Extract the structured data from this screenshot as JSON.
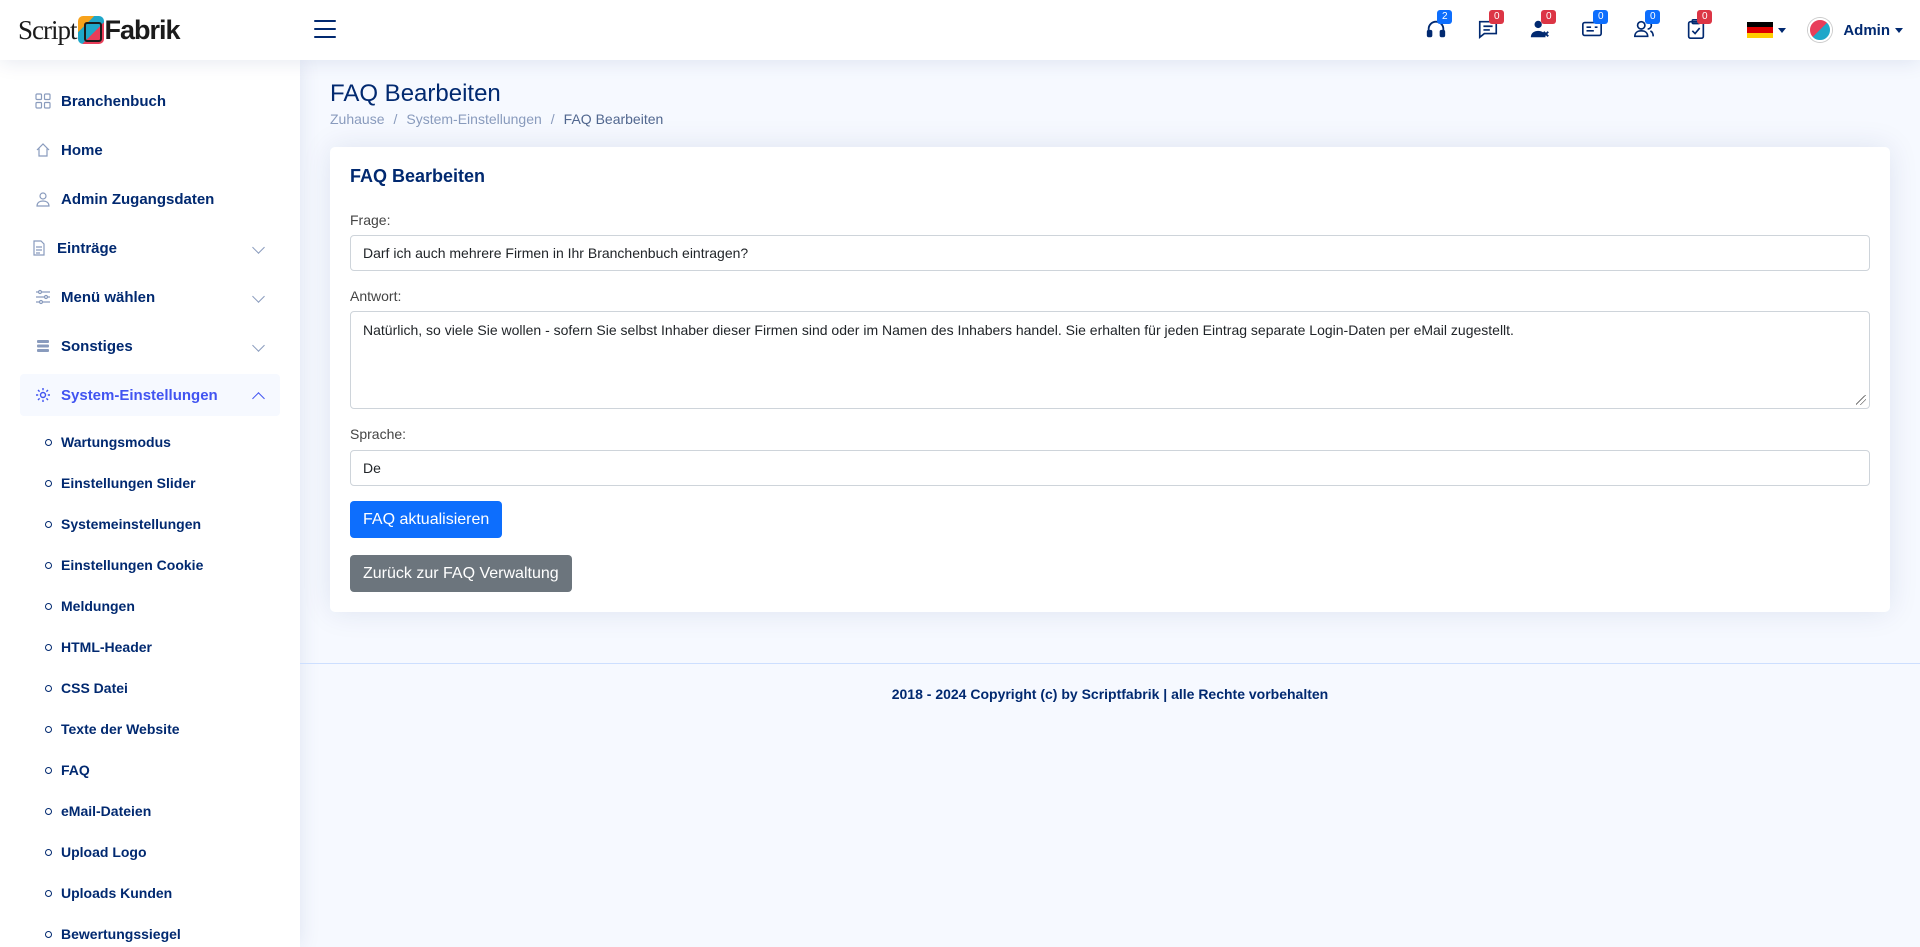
{
  "header": {
    "logo_script": "Script",
    "logo_fabrik": "Fabrik",
    "notifications": [
      {
        "icon": "headset-icon",
        "count": "2",
        "color": "blue"
      },
      {
        "icon": "chat-icon",
        "count": "0",
        "color": "red"
      },
      {
        "icon": "user-x-icon",
        "count": "0",
        "color": "red"
      },
      {
        "icon": "card-icon",
        "count": "0",
        "color": "blue"
      },
      {
        "icon": "users-icon",
        "count": "0",
        "color": "blue"
      },
      {
        "icon": "clipboard-check-icon",
        "count": "0",
        "color": "red"
      }
    ],
    "language_flag": "de",
    "user_name": "Admin"
  },
  "sidebar": {
    "items": [
      {
        "label": "Branchenbuch",
        "icon": "grid-icon"
      },
      {
        "label": "Home",
        "icon": "house-icon"
      },
      {
        "label": "Admin Zugangsdaten",
        "icon": "person-icon"
      },
      {
        "label": "Einträge",
        "icon": "file-icon",
        "expandable": true
      },
      {
        "label": "Menü wählen",
        "icon": "sliders-icon",
        "expandable": true
      },
      {
        "label": "Sonstiges",
        "icon": "stack-icon",
        "expandable": true
      },
      {
        "label": "System-Einstellungen",
        "icon": "gear-icon",
        "expandable": true,
        "expanded": true
      }
    ],
    "sub_items": [
      "Wartungsmodus",
      "Einstellungen Slider",
      "Systemeinstellungen",
      "Einstellungen Cookie",
      "Meldungen",
      "HTML-Header",
      "CSS Datei",
      "Texte der Website",
      "FAQ",
      "eMail-Dateien",
      "Upload Logo",
      "Uploads Kunden",
      "Bewertungssiegel"
    ]
  },
  "page": {
    "title": "FAQ Bearbeiten",
    "breadcrumb": [
      "Zuhause",
      "System-Einstellungen",
      "FAQ Bearbeiten"
    ]
  },
  "form": {
    "card_title": "FAQ Bearbeiten",
    "question_label": "Frage:",
    "question_value": "Darf ich auch mehrere Firmen in Ihr Branchenbuch eintragen?",
    "answer_label": "Antwort:",
    "answer_value": "Natürlich, so viele Sie wollen - sofern Sie selbst Inhaber dieser Firmen sind oder im Namen des Inhabers handel. Sie erhalten für jeden Eintrag separate Login-Daten per eMail zugestellt.",
    "language_label": "Sprache:",
    "language_value": "De",
    "submit_label": "FAQ aktualisieren",
    "back_label": "Zurück zur FAQ Verwaltung"
  },
  "footer": {
    "copyright": "2018 - 2024 Copyright (c) by Scriptfabrik | alle Rechte vorbehalten"
  }
}
